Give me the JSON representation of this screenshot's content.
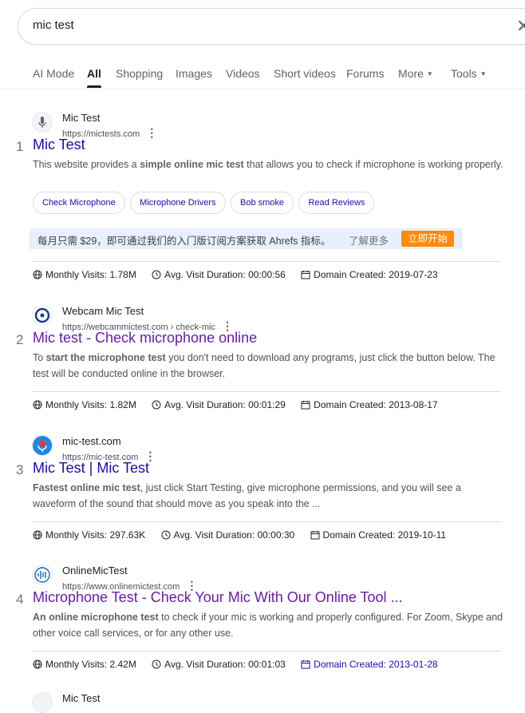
{
  "search": {
    "query": "mic test"
  },
  "tabs": [
    {
      "label": "AI Mode"
    },
    {
      "label": "All"
    },
    {
      "label": "Shopping"
    },
    {
      "label": "Images"
    },
    {
      "label": "Videos"
    },
    {
      "label": "Short videos"
    },
    {
      "label": "Forums"
    },
    {
      "label": "More"
    },
    {
      "label": "Tools"
    }
  ],
  "results": [
    {
      "rank": "1",
      "site_name": "Mic Test",
      "url": "https://mictests.com",
      "title": "Mic Test",
      "snippet_parts": [
        "This website provides a ",
        "simple online mic test",
        " that allows you to check if microphone is working properly."
      ],
      "sitelinks": [
        "Check Microphone",
        "Microphone Drivers",
        "Bob smoke",
        "Read Reviews"
      ],
      "promo": {
        "text": "每月只需 $29，即可通过我们的入门版订阅方案获取 Ahrefs 指标。",
        "more": "了解更多",
        "button": "立即开始"
      },
      "stats": {
        "visits": "Monthly Visits: 1.78M",
        "duration": "Avg. Visit Duration: 00:00:56",
        "created": "Domain Created: 2019-07-23"
      }
    },
    {
      "rank": "2",
      "site_name": "Webcam Mic Test",
      "url": "https://webcammictest.com › check-mic",
      "title": "Mic test - Check microphone online",
      "snippet_parts": [
        "To ",
        "start the microphone test",
        " you don't need to download any programs, just click the button below. The test will be conducted online in the browser."
      ],
      "stats": {
        "visits": "Monthly Visits: 1.82M",
        "duration": "Avg. Visit Duration: 00:01:29",
        "created": "Domain Created: 2013-08-17"
      }
    },
    {
      "rank": "3",
      "site_name": "mic-test.com",
      "url": "https://mic-test.com",
      "title": "Mic Test | Mic Test",
      "snippet_parts": [
        "",
        "Fastest online mic test",
        ", just click Start Testing, give microphone permissions, and you will see a waveform of the sound that should move as you speak into the ..."
      ],
      "stats": {
        "visits": "Monthly Visits: 297.63K",
        "duration": "Avg. Visit Duration: 00:00:30",
        "created": "Domain Created: 2019-10-11"
      }
    },
    {
      "rank": "4",
      "site_name": "OnlineMicTest",
      "url": "https://www.onlinemictest.com",
      "title": "Microphone Test - Check Your Mic With Our Online Tool ...",
      "snippet_parts": [
        "",
        "An online microphone test",
        " to check if your mic is working and properly configured. For Zoom, Skype and other voice call services, or for any other use."
      ],
      "stats": {
        "visits": "Monthly Visits: 2.42M",
        "duration": "Avg. Visit Duration: 00:01:03",
        "created": "Domain Created: 2013-01-28"
      }
    },
    {
      "site_name": "Mic Test"
    }
  ]
}
